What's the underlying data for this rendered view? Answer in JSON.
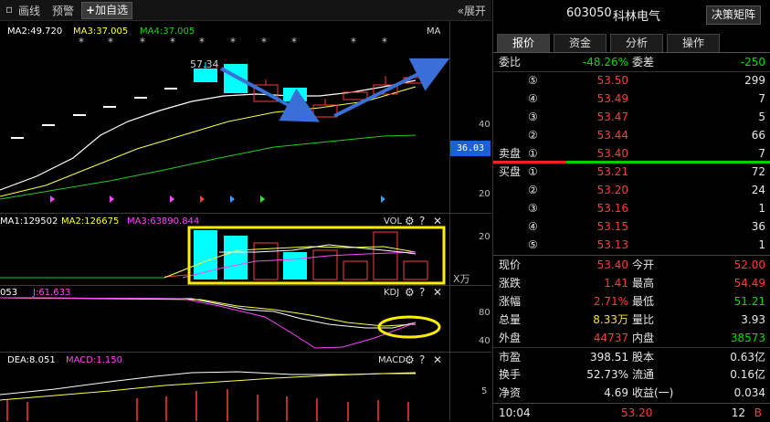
{
  "topbar": {
    "huaxian": "画线",
    "yujing": "预警",
    "add_fav": "加自选",
    "expand": "展开"
  },
  "ma_legend": {
    "ma2": "MA2:49.720",
    "ma3": "MA3:37.005",
    "ma4": "MA4:37.005",
    "ma_tag": "MA",
    "high_price": "57.34"
  },
  "price_axis": {
    "p40": "40",
    "p20": "20",
    "current_price": "36.03"
  },
  "vol_legend": {
    "ma1": "MA1:129502",
    "ma2": "MA2:126675",
    "ma3": "MA3:63890.844",
    "name": "VOL",
    "axis_20": "20",
    "unit": "X万"
  },
  "kdj_legend": {
    "d": "053",
    "j": "J:61.633",
    "name": "KDJ",
    "axis_80": "80",
    "axis_40": "40"
  },
  "macd_legend": {
    "dea": "DEA:8.051",
    "macd": "MACD:1.150",
    "name": "MACD",
    "axis_5": "5"
  },
  "icons": {
    "settings": "gear-icon",
    "close": "close-icon",
    "expand": "double-chevron-left-icon",
    "plus": "plus-icon"
  },
  "colors": {
    "up": "#ff3b3b",
    "down": "#00ffff",
    "ma_white": "#ffffff",
    "ma_yellow": "#ffff44",
    "ma_green": "#22cc22",
    "ma_magenta": "#ff44ff",
    "highlight": "#ffee00",
    "arrow": "#3a6fd8"
  },
  "stock": {
    "code": "603050",
    "name": "科林电气",
    "decision_button": "决策矩阵"
  },
  "tabs": [
    "报价",
    "资金",
    "分析",
    "操作"
  ],
  "order_book": {
    "weibi_label": "委比",
    "weibi_value": "-48.26%",
    "weicha_label": "委差",
    "weicha_value": "-250",
    "sell_label": "卖盘",
    "buy_label": "买盘",
    "sells": [
      {
        "level": "⑤",
        "price": "53.50",
        "vol": "299"
      },
      {
        "level": "④",
        "price": "53.49",
        "vol": "7"
      },
      {
        "level": "③",
        "price": "53.47",
        "vol": "5"
      },
      {
        "level": "②",
        "price": "53.44",
        "vol": "66"
      },
      {
        "level": "①",
        "price": "53.40",
        "vol": "7"
      }
    ],
    "buys": [
      {
        "level": "①",
        "price": "53.21",
        "vol": "72"
      },
      {
        "level": "②",
        "price": "53.20",
        "vol": "24"
      },
      {
        "level": "③",
        "price": "53.16",
        "vol": "1"
      },
      {
        "level": "④",
        "price": "53.15",
        "vol": "36"
      },
      {
        "level": "⑤",
        "price": "53.13",
        "vol": "1"
      }
    ]
  },
  "stats": [
    {
      "l1": "现价",
      "v1": "53.40",
      "c1": "red",
      "l2": "今开",
      "v2": "52.00",
      "c2": "red"
    },
    {
      "l1": "涨跌",
      "v1": "1.41",
      "c1": "red",
      "l2": "最高",
      "v2": "54.49",
      "c2": "red"
    },
    {
      "l1": "涨幅",
      "v1": "2.71%",
      "c1": "red",
      "l2": "最低",
      "v2": "51.21",
      "c2": "green"
    },
    {
      "l1": "总量",
      "v1": "8.33万",
      "c1": "ylw",
      "l2": "量比",
      "v2": "3.93",
      "c2": "white"
    },
    {
      "l1": "外盘",
      "v1": "44737",
      "c1": "red",
      "l2": "内盘",
      "v2": "38573",
      "c2": "green"
    },
    {
      "l1": "市盈",
      "v1": "398.51",
      "c1": "white",
      "l2": "股本",
      "v2": "0.63亿",
      "c2": "white"
    },
    {
      "l1": "换手",
      "v1": "52.73%",
      "c1": "white",
      "l2": "流通",
      "v2": "0.16亿",
      "c2": "white"
    },
    {
      "l1": "净资",
      "v1": "4.69",
      "c1": "white",
      "l2": "收益(一)",
      "v2": "0.034",
      "c2": "white"
    }
  ],
  "tick": {
    "time": "10:04",
    "price": "53.20",
    "vol": "12",
    "side": "B"
  }
}
